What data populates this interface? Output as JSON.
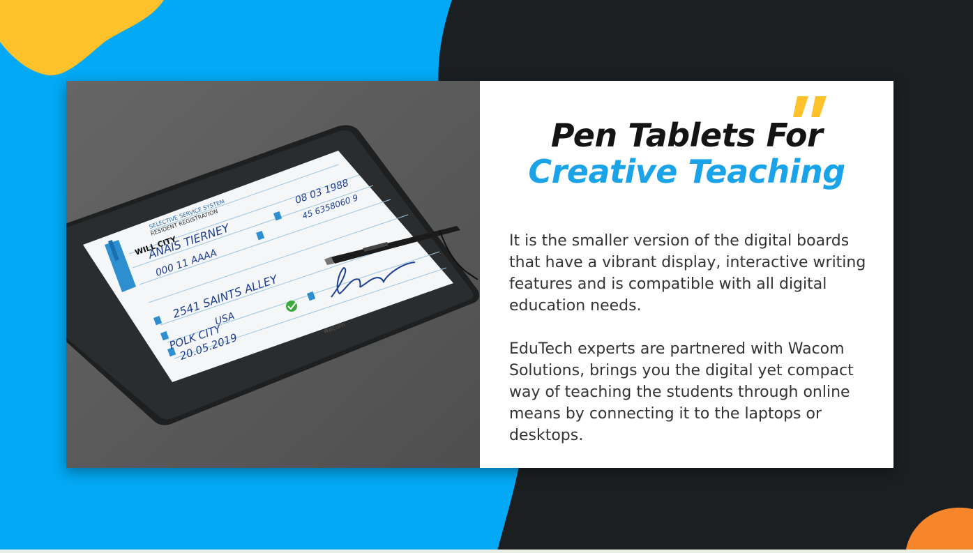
{
  "colors": {
    "blue": "#03a9f4",
    "dark": "#1b1f22",
    "yellow": "#fdc12b",
    "orange": "#f7852a",
    "accent": "#1aa3e8"
  },
  "title": {
    "line1": "Pen Tablets For",
    "line2": "Creative Teaching"
  },
  "paragraphs": [
    "It is the smaller version of the digital boards that have a vibrant display, interactive writing features and is compatible with all digital education needs.",
    "EduTech experts are partnered with Wacom Solutions, brings you the digital yet compact way of teaching the students through online means by connecting it to the laptops or desktops."
  ],
  "tablet_screen": {
    "header_line1": "SELECTIVE SERVICE SYSTEM",
    "header_line2": "RESIDENT REGISTRATION",
    "logo": "WILL CITY",
    "name": "ANAIS TIERNEY",
    "id": "000 11 AAAA",
    "date": "08 03 1988",
    "number": "45 6358060 9",
    "address": "2541 SAINTS ALLEY",
    "country": "USA",
    "city": "POLK CITY",
    "signed_date": "20.05.2019",
    "brand": "wacom"
  }
}
